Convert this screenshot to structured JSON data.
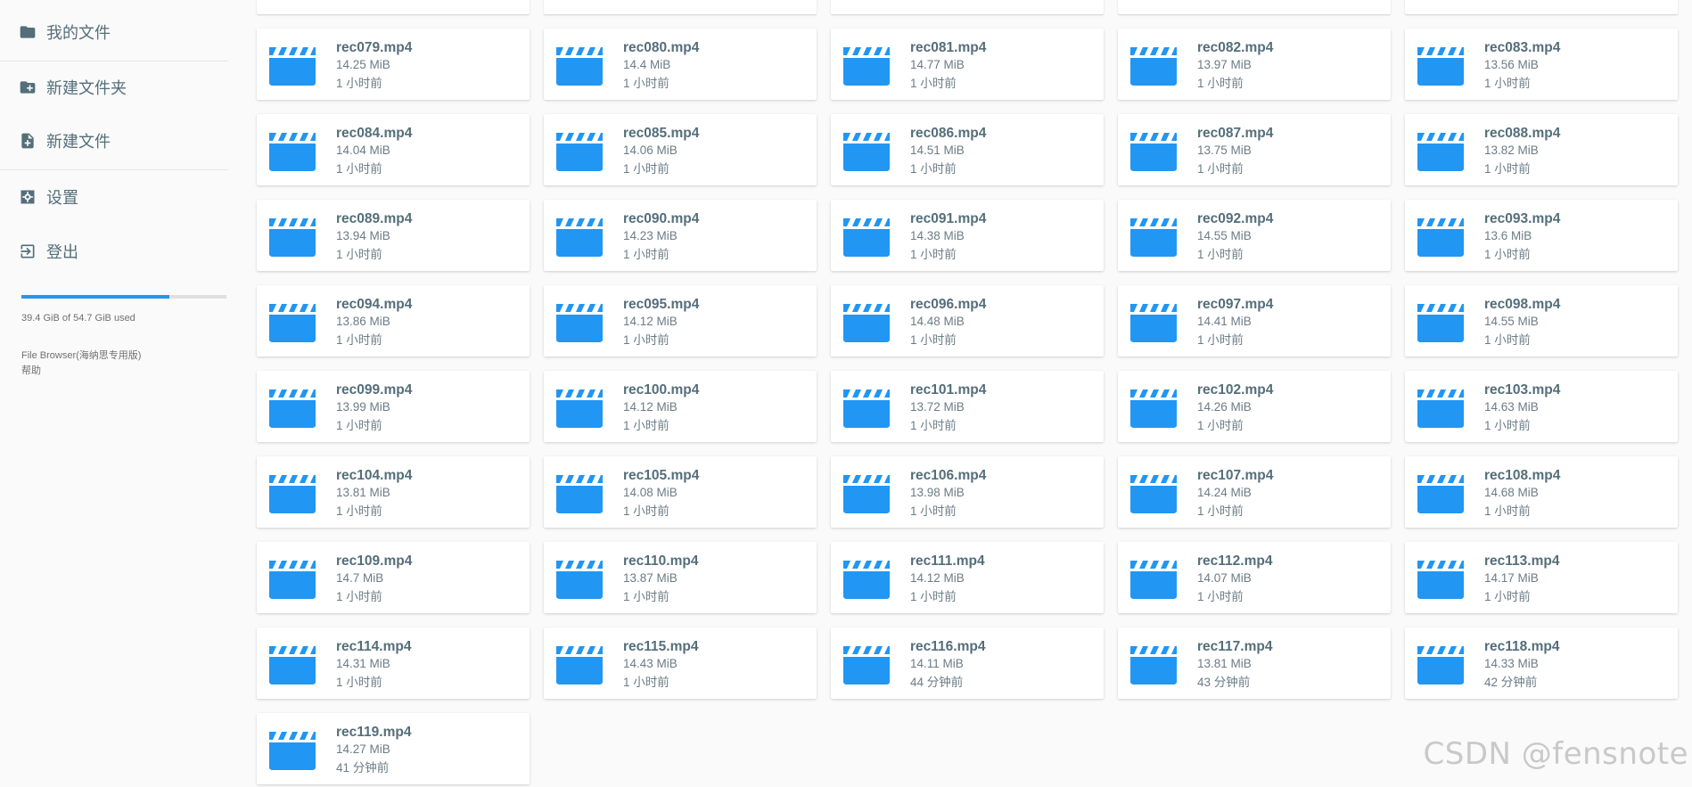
{
  "sidebar": {
    "items": [
      {
        "label": "我的文件",
        "icon": "folder-icon"
      },
      {
        "label": "新建文件夹",
        "icon": "create-new-folder-icon"
      },
      {
        "label": "新建文件",
        "icon": "note-add-icon"
      },
      {
        "label": "设置",
        "icon": "settings-icon"
      },
      {
        "label": "登出",
        "icon": "exit-icon"
      }
    ],
    "usage": {
      "text": "39.4 GiB of 54.7 GiB used",
      "fraction": 0.72
    },
    "footer": {
      "title": "File Browser(海纳思专用版)",
      "help": "帮助"
    }
  },
  "colors": {
    "accent": "#2196f3",
    "text": "#546e7a"
  },
  "files": [
    {
      "name": "rec079.mp4",
      "size": "14.25 MiB",
      "time": "1 小时前"
    },
    {
      "name": "rec080.mp4",
      "size": "14.4 MiB",
      "time": "1 小时前"
    },
    {
      "name": "rec081.mp4",
      "size": "14.77 MiB",
      "time": "1 小时前"
    },
    {
      "name": "rec082.mp4",
      "size": "13.97 MiB",
      "time": "1 小时前"
    },
    {
      "name": "rec083.mp4",
      "size": "13.56 MiB",
      "time": "1 小时前"
    },
    {
      "name": "rec084.mp4",
      "size": "14.04 MiB",
      "time": "1 小时前"
    },
    {
      "name": "rec085.mp4",
      "size": "14.06 MiB",
      "time": "1 小时前"
    },
    {
      "name": "rec086.mp4",
      "size": "14.51 MiB",
      "time": "1 小时前"
    },
    {
      "name": "rec087.mp4",
      "size": "13.75 MiB",
      "time": "1 小时前"
    },
    {
      "name": "rec088.mp4",
      "size": "13.82 MiB",
      "time": "1 小时前"
    },
    {
      "name": "rec089.mp4",
      "size": "13.94 MiB",
      "time": "1 小时前"
    },
    {
      "name": "rec090.mp4",
      "size": "14.23 MiB",
      "time": "1 小时前"
    },
    {
      "name": "rec091.mp4",
      "size": "14.38 MiB",
      "time": "1 小时前"
    },
    {
      "name": "rec092.mp4",
      "size": "14.55 MiB",
      "time": "1 小时前"
    },
    {
      "name": "rec093.mp4",
      "size": "13.6 MiB",
      "time": "1 小时前"
    },
    {
      "name": "rec094.mp4",
      "size": "13.86 MiB",
      "time": "1 小时前"
    },
    {
      "name": "rec095.mp4",
      "size": "14.12 MiB",
      "time": "1 小时前"
    },
    {
      "name": "rec096.mp4",
      "size": "14.48 MiB",
      "time": "1 小时前"
    },
    {
      "name": "rec097.mp4",
      "size": "14.41 MiB",
      "time": "1 小时前"
    },
    {
      "name": "rec098.mp4",
      "size": "14.55 MiB",
      "time": "1 小时前"
    },
    {
      "name": "rec099.mp4",
      "size": "13.99 MiB",
      "time": "1 小时前"
    },
    {
      "name": "rec100.mp4",
      "size": "14.12 MiB",
      "time": "1 小时前"
    },
    {
      "name": "rec101.mp4",
      "size": "13.72 MiB",
      "time": "1 小时前"
    },
    {
      "name": "rec102.mp4",
      "size": "14.26 MiB",
      "time": "1 小时前"
    },
    {
      "name": "rec103.mp4",
      "size": "14.63 MiB",
      "time": "1 小时前"
    },
    {
      "name": "rec104.mp4",
      "size": "13.81 MiB",
      "time": "1 小时前"
    },
    {
      "name": "rec105.mp4",
      "size": "14.08 MiB",
      "time": "1 小时前"
    },
    {
      "name": "rec106.mp4",
      "size": "13.98 MiB",
      "time": "1 小时前"
    },
    {
      "name": "rec107.mp4",
      "size": "14.24 MiB",
      "time": "1 小时前"
    },
    {
      "name": "rec108.mp4",
      "size": "14.68 MiB",
      "time": "1 小时前"
    },
    {
      "name": "rec109.mp4",
      "size": "14.7 MiB",
      "time": "1 小时前"
    },
    {
      "name": "rec110.mp4",
      "size": "13.87 MiB",
      "time": "1 小时前"
    },
    {
      "name": "rec111.mp4",
      "size": "14.12 MiB",
      "time": "1 小时前"
    },
    {
      "name": "rec112.mp4",
      "size": "14.07 MiB",
      "time": "1 小时前"
    },
    {
      "name": "rec113.mp4",
      "size": "14.17 MiB",
      "time": "1 小时前"
    },
    {
      "name": "rec114.mp4",
      "size": "14.31 MiB",
      "time": "1 小时前"
    },
    {
      "name": "rec115.mp4",
      "size": "14.43 MiB",
      "time": "1 小时前"
    },
    {
      "name": "rec116.mp4",
      "size": "14.11 MiB",
      "time": "44 分钟前"
    },
    {
      "name": "rec117.mp4",
      "size": "13.81 MiB",
      "time": "43 分钟前"
    },
    {
      "name": "rec118.mp4",
      "size": "14.33 MiB",
      "time": "42 分钟前"
    },
    {
      "name": "rec119.mp4",
      "size": "14.27 MiB",
      "time": "41 分钟前"
    }
  ],
  "watermark": "CSDN @fensnote"
}
